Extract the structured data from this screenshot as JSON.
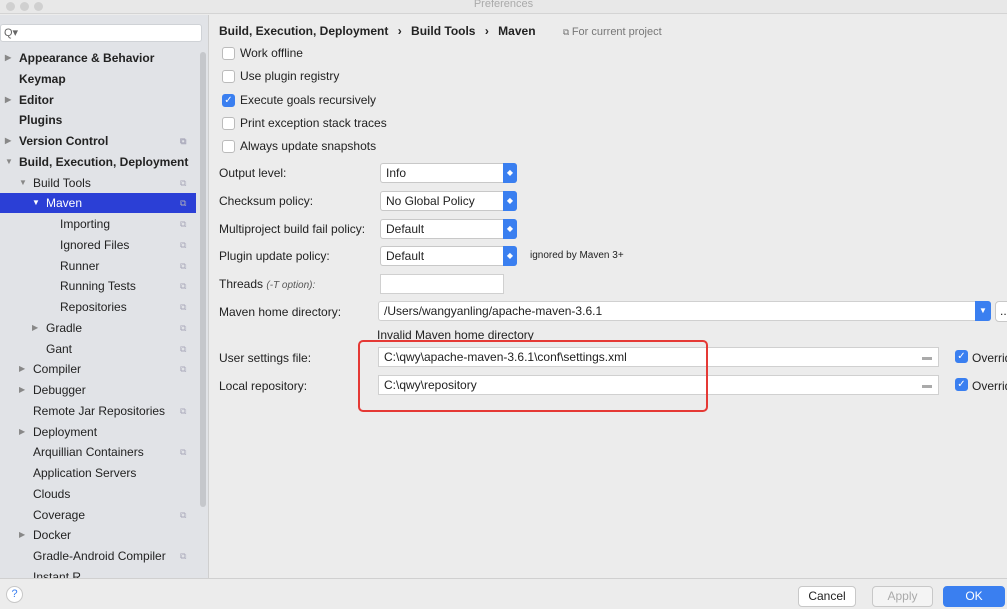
{
  "window": {
    "title": "Preferences"
  },
  "sidebar": {
    "search_placeholder": "Q▾",
    "items": [
      {
        "label": "Appearance & Behavior",
        "arrow": "▶"
      },
      {
        "label": "Keymap"
      },
      {
        "label": "Editor",
        "arrow": "▶"
      },
      {
        "label": "Plugins"
      },
      {
        "label": "Version Control",
        "arrow": "▶"
      },
      {
        "label": "Build, Execution, Deployment",
        "arrow": "▼"
      },
      {
        "label": "Build Tools",
        "arrow": "▼"
      },
      {
        "label": "Maven",
        "arrow": "▼"
      },
      {
        "label": "Importing"
      },
      {
        "label": "Ignored Files"
      },
      {
        "label": "Runner"
      },
      {
        "label": "Running Tests"
      },
      {
        "label": "Repositories"
      },
      {
        "label": "Gradle",
        "arrow": "▶"
      },
      {
        "label": "Gant"
      },
      {
        "label": "Compiler",
        "arrow": "▶"
      },
      {
        "label": "Debugger",
        "arrow": "▶"
      },
      {
        "label": "Remote Jar Repositories"
      },
      {
        "label": "Deployment",
        "arrow": "▶"
      },
      {
        "label": "Arquillian Containers"
      },
      {
        "label": "Application Servers"
      },
      {
        "label": "Clouds"
      },
      {
        "label": "Coverage"
      },
      {
        "label": "Docker",
        "arrow": "▶"
      },
      {
        "label": "Gradle-Android Compiler"
      },
      {
        "label": "Instant R..."
      }
    ]
  },
  "breadcrumb": {
    "items": [
      "Build, Execution, Deployment",
      "Build Tools",
      "Maven"
    ],
    "sep": "›",
    "scope": "For current project"
  },
  "checkboxes": [
    {
      "label": "Work offline",
      "checked": false
    },
    {
      "label": "Use plugin registry",
      "checked": false
    },
    {
      "label": "Execute goals recursively",
      "checked": true
    },
    {
      "label": "Print exception stack traces",
      "checked": false
    },
    {
      "label": "Always update snapshots",
      "checked": false
    }
  ],
  "form": {
    "output_level": {
      "label": "Output level:",
      "value": "Info"
    },
    "checksum": {
      "label": "Checksum policy:",
      "value": "No Global Policy"
    },
    "multiproject": {
      "label": "Multiproject build fail policy:",
      "value": "Default"
    },
    "plugin_update": {
      "label": "Plugin update policy:",
      "value": "Default",
      "note": "ignored by Maven 3+"
    },
    "threads": {
      "label": "Threads",
      "hint": "(-T option):",
      "value": ""
    },
    "maven_home": {
      "label": "Maven home directory:",
      "value": "/Users/wangyanling/apache-maven-3.6.1",
      "browse": "...",
      "error": "Invalid Maven home directory"
    },
    "user_settings": {
      "label": "User settings file:",
      "value": "C:\\qwy\\apache-maven-3.6.1\\conf\\settings.xml",
      "override": "Overrid"
    },
    "local_repo": {
      "label": "Local repository:",
      "value": "C:\\qwy\\repository",
      "override": "Overrid"
    }
  },
  "footer": {
    "help": "?",
    "cancel": "Cancel",
    "apply": "Apply",
    "ok": "OK"
  },
  "colors": {
    "accent": "#2b3fd6",
    "checkbox": "#3a7ff0",
    "annotation": "#e53935"
  }
}
